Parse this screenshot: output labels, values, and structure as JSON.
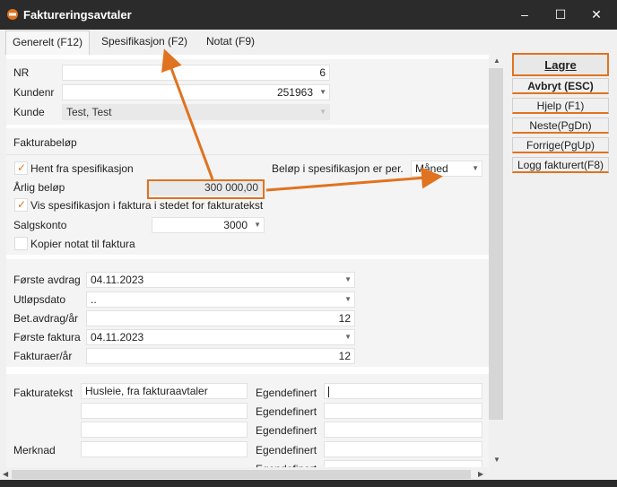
{
  "window": {
    "title": "Faktureringsavtaler"
  },
  "tabs": [
    "Generelt (F12)",
    "Spesifikasjon (F2)",
    "Notat (F9)"
  ],
  "header": {
    "nr_label": "NR",
    "nr_value": "6",
    "kundenr_label": "Kundenr",
    "kundenr_value": "251963",
    "kunde_label": "Kunde",
    "kunde_value": "Test, Test"
  },
  "billing": {
    "section_title": "Fakturabeløp",
    "hent_label": "Hent fra spesifikasjon",
    "period_label": "Beløp i spesifikasjon er per.",
    "period_value": "Måned",
    "annual_label": "Årlig beløp",
    "annual_value": "300 000,00",
    "vis_label": "Vis spesifikasjon i faktura i stedet for fakturatekst",
    "salgskonto_label": "Salgskonto",
    "salgskonto_value": "3000",
    "kopier_label": "Kopier notat til faktura"
  },
  "schedule": {
    "forste_avdrag_label": "Første avdrag",
    "forste_avdrag_value": "04.11.2023",
    "utlopsdato_label": "Utløpsdato",
    "utlopsdato_value": "..",
    "bet_label": "Bet.avdrag/år",
    "bet_value": "12",
    "forste_faktura_label": "Første faktura",
    "forste_faktura_value": "04.11.2023",
    "fakturaer_label": "Fakturaer/år",
    "fakturaer_value": "12"
  },
  "texts": {
    "fakturatekst_label": "Fakturatekst",
    "fakturatekst_value": "Husleie, fra fakturaavtaler",
    "merknad_label": "Merknad",
    "egendefinert_label": "Egendefinert"
  },
  "buttons": {
    "lagre": "Lagre",
    "avbryt": "Avbryt (ESC)",
    "hjelp": "Hjelp (F1)",
    "neste": "Neste(PgDn)",
    "forrige": "Forrige(PgUp)",
    "logg": "Logg fakturert(F8)"
  },
  "icons": {
    "app": "app-logo-icon",
    "minimize": "minimize-icon",
    "maximize": "maximize-icon",
    "close": "close-icon",
    "dropdown": "chevron-down-icon",
    "check": "checkmark-icon"
  },
  "colors": {
    "accent": "#e07320",
    "titlebar": "#2b2b2b"
  }
}
